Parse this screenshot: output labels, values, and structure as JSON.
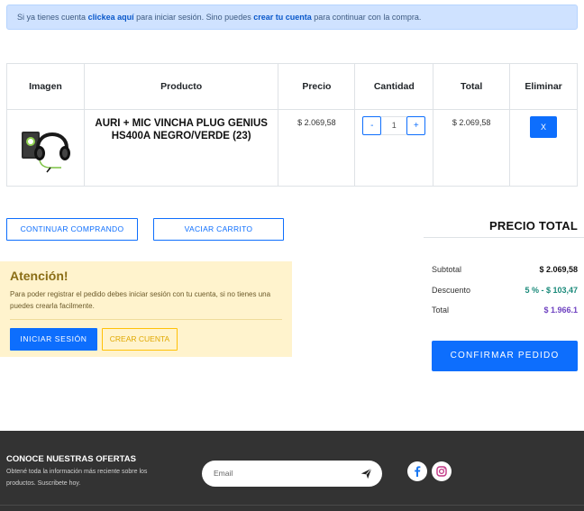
{
  "alert": {
    "prefix": "Si ya tienes cuenta",
    "login_link": "clickea aquí",
    "middle": "para iniciar sesión. Sino puedes",
    "create_link": "crear tu cuenta",
    "suffix": "para continuar con la compra."
  },
  "cart": {
    "headers": [
      "Imagen",
      "Producto",
      "Precio",
      "Cantidad",
      "Total",
      "Eliminar"
    ],
    "items": [
      {
        "image": "headphones-image",
        "name": "AURI + MIC VINCHA PLUG GENIUS HS400A NEGRO/VERDE (23)",
        "price": "$ 2.069,58",
        "quantity": "1",
        "total": "$ 2.069,58",
        "minus": "-",
        "plus": "+",
        "delete": "X"
      }
    ]
  },
  "actions": {
    "continue": "CONTINUAR COMPRANDO",
    "empty": "VACIAR CARRITO"
  },
  "summary": {
    "title": "PRECIO TOTAL",
    "subtotal_label": "Subtotal",
    "subtotal_value": "$ 2.069,58",
    "discount_label": "Descuento",
    "discount_value": "5 % - $ 103,47",
    "total_label": "Total",
    "total_value": "$ 1.966.1",
    "confirm": "CONFIRMAR PEDIDO"
  },
  "notice": {
    "title": "Atención!",
    "text": "Para poder registrar el pedido debes iniciar sesión con tu cuenta, si no tienes una puedes crearla facilmente.",
    "login": "INICIAR SESIÓN",
    "create": "CREAR CUENTA"
  },
  "footer": {
    "title": "CONOCE NUESTRAS OFERTAS",
    "text": "Obtené toda la información más reciente sobre los productos. Suscribete hoy.",
    "email_placeholder": "Email",
    "icons": [
      "facebook-icon",
      "instagram-icon",
      "send-icon"
    ]
  },
  "colors": {
    "primary": "#0d6efd",
    "alert_bg": "#cfe2ff",
    "warning_bg": "#fff3cd",
    "warning_border": "#ffc107",
    "discount": "#1a8a7a",
    "total": "#6f42c1",
    "footer_bg": "#333333"
  }
}
